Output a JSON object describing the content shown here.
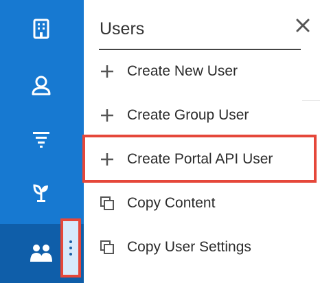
{
  "sidebar": {
    "items": [
      {
        "icon": "building-icon"
      },
      {
        "icon": "user-icon"
      },
      {
        "icon": "filter-icon"
      },
      {
        "icon": "sprout-icon"
      },
      {
        "icon": "users-icon"
      }
    ],
    "active_index": 4,
    "color": "#1779d1",
    "active_color": "#0f5ea9"
  },
  "menu": {
    "title": "Users",
    "close_icon": "close-icon",
    "items": [
      {
        "label": "Create New User",
        "icon": "plus-icon"
      },
      {
        "label": "Create Group User",
        "icon": "plus-icon"
      },
      {
        "label": "Create Portal API User",
        "icon": "plus-icon",
        "highlighted": true
      },
      {
        "label": "Copy Content",
        "icon": "copy-icon"
      },
      {
        "label": "Copy User Settings",
        "icon": "copy-icon"
      }
    ]
  },
  "highlight_color": "#e5473a"
}
